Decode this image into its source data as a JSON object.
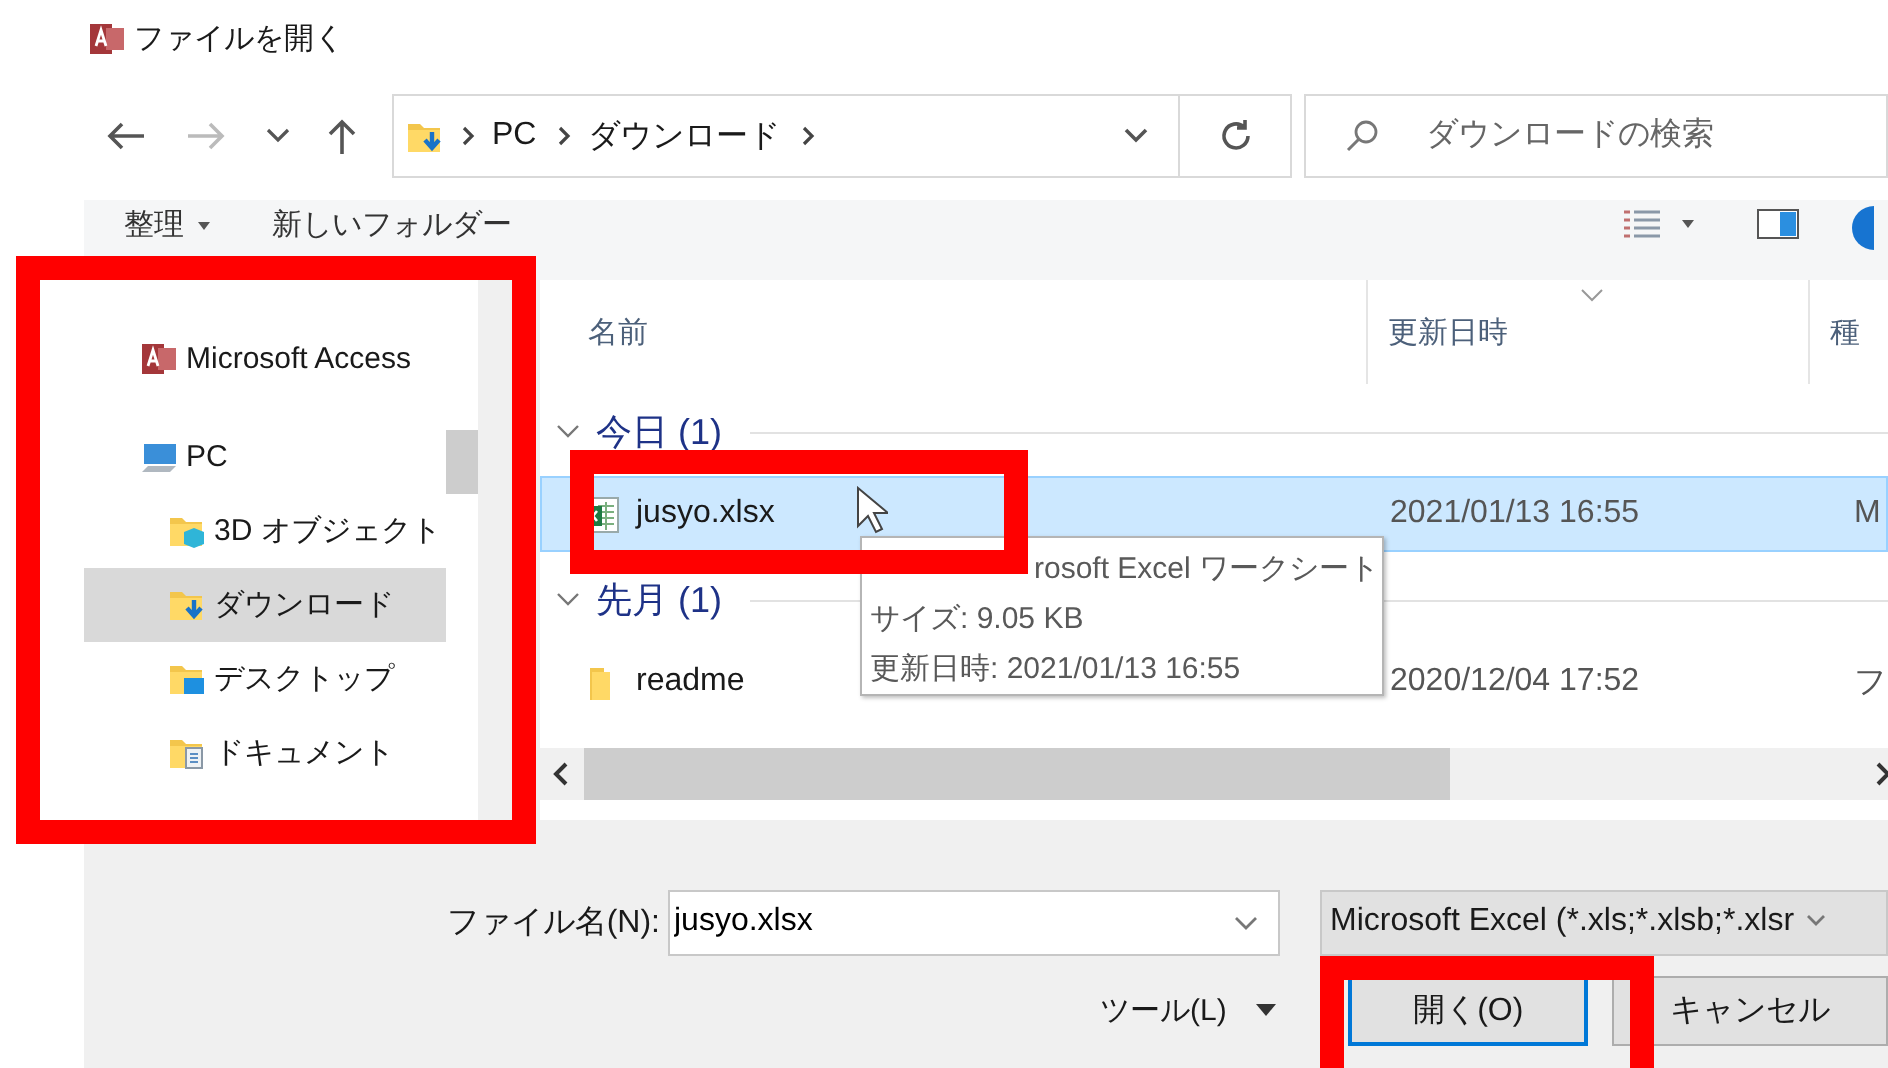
{
  "window": {
    "title": "ファイルを開く"
  },
  "address": {
    "path": [
      "PC",
      "ダウンロード"
    ]
  },
  "search": {
    "placeholder": "ダウンロードの検索"
  },
  "toolbar": {
    "items": [
      {
        "label": "整理",
        "dropdown": true
      },
      {
        "label": "新しいフォルダー",
        "dropdown": false
      }
    ]
  },
  "nav_pane": {
    "items": [
      {
        "label": "Microsoft Access",
        "kind": "access",
        "selected": false
      },
      {
        "label": "PC",
        "kind": "pc",
        "selected": false,
        "children": [
          {
            "label": "3D オブジェクト",
            "kind": "folder-3d",
            "selected": false
          },
          {
            "label": "ダウンロード",
            "kind": "folder-download",
            "selected": true
          },
          {
            "label": "デスクトップ",
            "kind": "folder-desktop",
            "selected": false
          },
          {
            "label": "ドキュメント",
            "kind": "folder-documents",
            "selected": false
          }
        ]
      }
    ]
  },
  "file_list": {
    "columns": [
      "名前",
      "更新日時",
      "種"
    ],
    "groups": [
      {
        "label": "今日 (1)",
        "expanded": true,
        "items": [
          {
            "name": "jusyo.xlsx",
            "kind": "excel",
            "modified": "2021/01/13 16:55",
            "column_3": "M",
            "selected": true
          }
        ]
      },
      {
        "label": "先月 (1)",
        "expanded": true,
        "items": [
          {
            "name": "readme",
            "kind": "folder",
            "modified": "2020/12/04 17:52",
            "column_3": "フ",
            "selected": false
          }
        ]
      }
    ]
  },
  "tooltip": {
    "lines": [
      "rosoft Excel ワークシート",
      "サイズ: 9.05 KB",
      "更新日時: 2021/01/13 16:55"
    ]
  },
  "file_name": {
    "label": "ファイル名(N):",
    "value": "jusyo.xlsx"
  },
  "file_type": {
    "value": "Microsoft Excel (*.xls;*.xlsb;*.xlsr"
  },
  "buttons": {
    "tools": "ツール(L)",
    "open": "開く(O)",
    "cancel": "キャンセル"
  }
}
